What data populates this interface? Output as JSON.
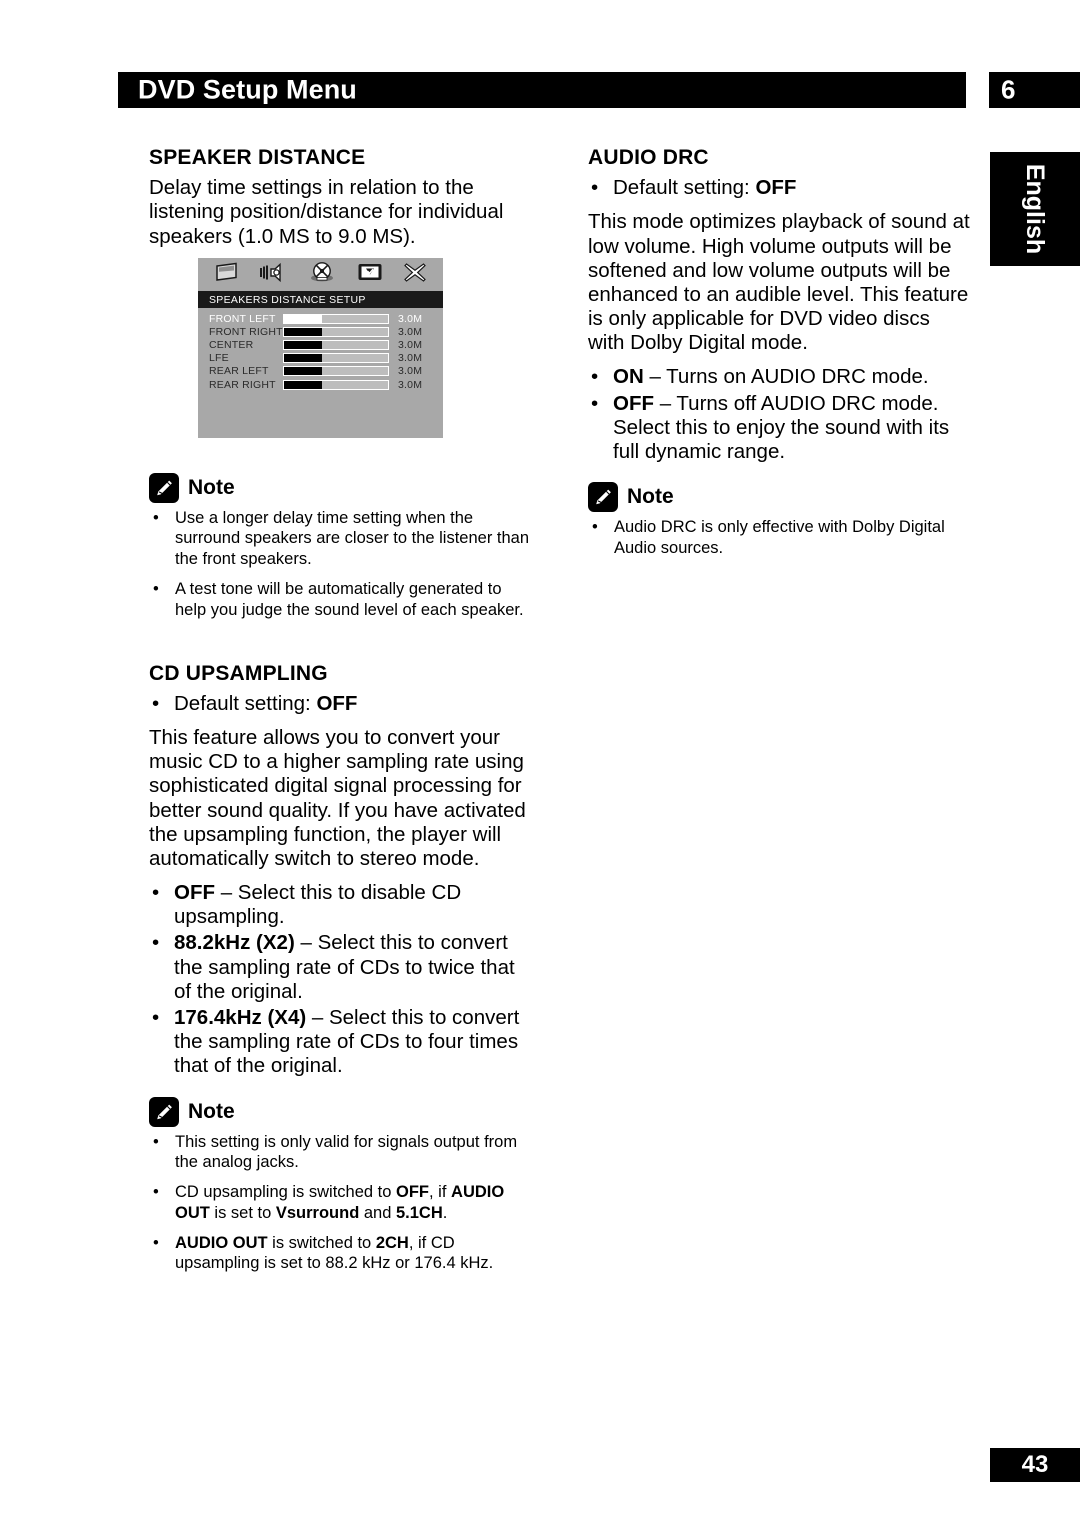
{
  "header": {
    "title": "DVD Setup Menu",
    "chapter_number": "6"
  },
  "language_tab": {
    "label": "English"
  },
  "footer": {
    "page_number": "43"
  },
  "left_column": {
    "speaker_distance": {
      "heading": "SPEAKER DISTANCE",
      "paragraph": "Delay time settings in relation to the listening position/distance for individual speakers (1.0 MS to 9.0 MS)."
    },
    "note_1": {
      "title": "Note",
      "items": [
        "Use a longer delay time setting when the surround speakers are closer to the listener than the front speakers.",
        "A test tone will be automatically generated to help you judge the sound level of each speaker."
      ]
    },
    "cd_upsampling": {
      "heading": "CD UPSAMPLING",
      "default_setting_label": "Default setting:",
      "default_setting_value": "OFF",
      "paragraph": "This feature allows you to convert your music CD to a higher sampling rate using sophisticated digital signal processing for better sound quality. If you have activated the upsampling function, the player will automatically switch to stereo mode.",
      "options": [
        {
          "term": "OFF",
          "description": " – Select this to disable CD upsampling."
        },
        {
          "term": "88.2kHz (X2)",
          "description": " – Select this to convert the sampling rate of CDs to twice that of the original."
        },
        {
          "term": "176.4kHz (X4)",
          "description": " – Select this to convert the sampling rate of CDs to four times that of the original."
        }
      ]
    },
    "note_2": {
      "title": "Note",
      "items": [
        {
          "parts": [
            {
              "text": "This setting is only valid for signals output from the analog jacks.",
              "bold": false
            }
          ]
        },
        {
          "parts": [
            {
              "text": "CD upsampling is switched to ",
              "bold": false
            },
            {
              "text": "OFF",
              "bold": true
            },
            {
              "text": ", if ",
              "bold": false
            },
            {
              "text": "AUDIO OUT",
              "bold": true
            },
            {
              "text": " is set to ",
              "bold": false
            },
            {
              "text": "Vsurround",
              "bold": true
            },
            {
              "text": " and ",
              "bold": false
            },
            {
              "text": "5.1CH",
              "bold": true
            },
            {
              "text": ".",
              "bold": false
            }
          ]
        },
        {
          "parts": [
            {
              "text": "AUDIO OUT",
              "bold": true
            },
            {
              "text": " is switched to ",
              "bold": false
            },
            {
              "text": "2CH",
              "bold": true
            },
            {
              "text": ", if CD upsampling is set to 88.2 kHz or 176.4 kHz.",
              "bold": false
            }
          ]
        }
      ]
    }
  },
  "right_column": {
    "audio_drc": {
      "heading": "AUDIO DRC",
      "default_setting_label": "Default setting:",
      "default_setting_value": "OFF",
      "paragraph": "This mode optimizes playback of sound at low volume. High volume outputs will be softened and low volume outputs will be enhanced to an audible level. This feature is only applicable for DVD video discs with Dolby Digital mode.",
      "options": [
        {
          "term": "ON",
          "description": " – Turns on AUDIO DRC mode."
        },
        {
          "term": "OFF",
          "description": " – Turns off AUDIO DRC mode. Select this to enjoy the sound with its full dynamic range."
        }
      ]
    },
    "note": {
      "title": "Note",
      "items": [
        "Audio DRC is only effective with Dolby Digital Audio sources."
      ]
    }
  },
  "osd_screenshot": {
    "title": "SPEAKERS DISTANCE SETUP",
    "icons": [
      "display-icon",
      "speaker-audio-icon",
      "disc-icon",
      "preferences-icon",
      "exit-icon"
    ],
    "rows": [
      {
        "label": "FRONT LEFT",
        "value": "3.0M",
        "selected": true
      },
      {
        "label": "FRONT RIGHT",
        "value": "3.0M",
        "selected": false
      },
      {
        "label": "CENTER",
        "value": "3.0M",
        "selected": false
      },
      {
        "label": "LFE",
        "value": "3.0M",
        "selected": false
      },
      {
        "label": "REAR LEFT",
        "value": "3.0M",
        "selected": false
      },
      {
        "label": "REAR RIGHT",
        "value": "3.0M",
        "selected": false
      }
    ]
  },
  "bullet_char": "•",
  "colors": {
    "ink": "#000000",
    "paper": "#ffffff",
    "osd_background": "#a8a8a8",
    "osd_titlebar": "#1a1a1a"
  }
}
